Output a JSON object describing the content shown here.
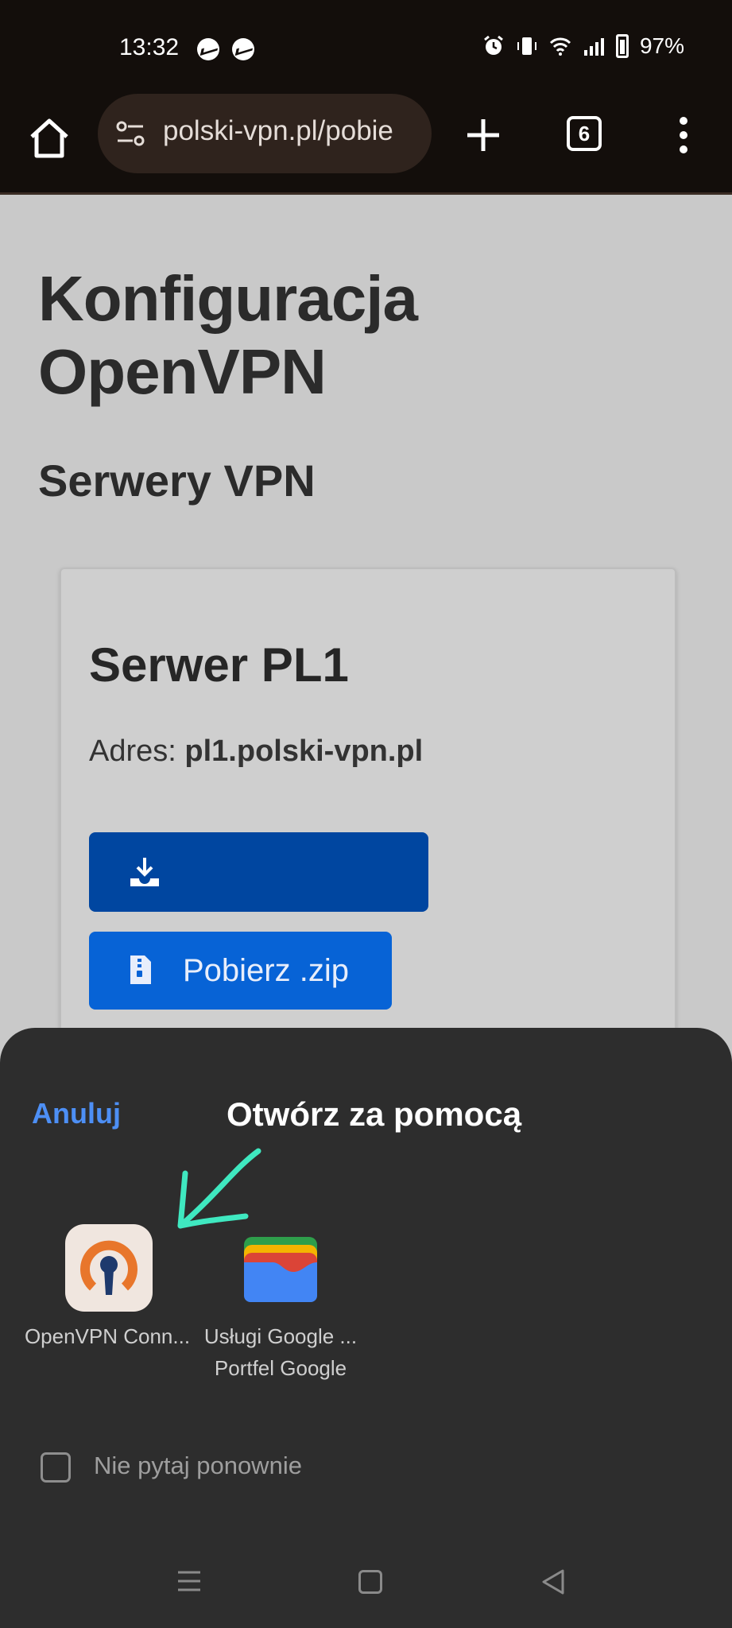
{
  "status_bar": {
    "time": "13:32",
    "battery": "97%",
    "icons": [
      "messenger-icon",
      "messenger-icon",
      "alarm-icon",
      "vibrate-icon",
      "wifi-icon",
      "signal-icon",
      "battery-icon"
    ]
  },
  "browser": {
    "url": "polski-vpn.pl/pobie",
    "tab_count": "6"
  },
  "page": {
    "title_line1": "Konfiguracja",
    "title_line2": "OpenVPN",
    "section_title": "Serwery VPN",
    "card": {
      "title": "Serwer PL1",
      "address_label": "Adres:",
      "address_value": "pl1.polski-vpn.pl",
      "zip_button": "Pobierz .zip"
    }
  },
  "sheet": {
    "cancel": "Anuluj",
    "title": "Otwórz za pomocą",
    "apps": [
      {
        "label": "OpenVPN Conn..."
      },
      {
        "label": "Usługi Google ...",
        "sublabel": "Portfel Google"
      }
    ],
    "checkbox_label": "Nie pytaj ponownie"
  },
  "colors": {
    "bar_bg": "#130e0b",
    "primary_dark": "#0046a0",
    "primary": "#0763d6",
    "link": "#4d8ff5",
    "arrow": "#3fe8c0"
  }
}
